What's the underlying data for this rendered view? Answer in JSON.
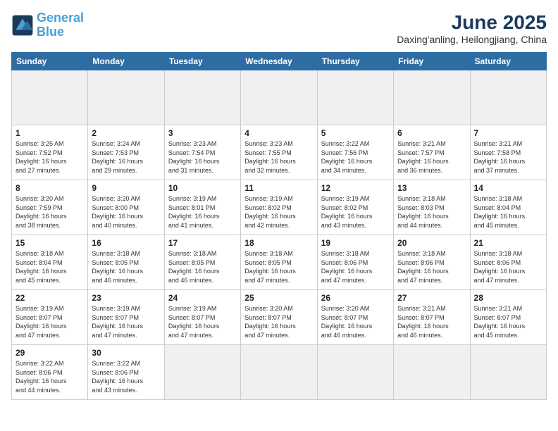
{
  "logo": {
    "line1": "General",
    "line2": "Blue"
  },
  "title": "June 2025",
  "location": "Daxing'anling, Heilongjiang, China",
  "weekdays": [
    "Sunday",
    "Monday",
    "Tuesday",
    "Wednesday",
    "Thursday",
    "Friday",
    "Saturday"
  ],
  "days": [
    {
      "num": "",
      "info": ""
    },
    {
      "num": "",
      "info": ""
    },
    {
      "num": "",
      "info": ""
    },
    {
      "num": "",
      "info": ""
    },
    {
      "num": "",
      "info": ""
    },
    {
      "num": "",
      "info": ""
    },
    {
      "num": "",
      "info": ""
    },
    {
      "num": "1",
      "info": "Sunrise: 3:25 AM\nSunset: 7:52 PM\nDaylight: 16 hours\nand 27 minutes."
    },
    {
      "num": "2",
      "info": "Sunrise: 3:24 AM\nSunset: 7:53 PM\nDaylight: 16 hours\nand 29 minutes."
    },
    {
      "num": "3",
      "info": "Sunrise: 3:23 AM\nSunset: 7:54 PM\nDaylight: 16 hours\nand 31 minutes."
    },
    {
      "num": "4",
      "info": "Sunrise: 3:23 AM\nSunset: 7:55 PM\nDaylight: 16 hours\nand 32 minutes."
    },
    {
      "num": "5",
      "info": "Sunrise: 3:22 AM\nSunset: 7:56 PM\nDaylight: 16 hours\nand 34 minutes."
    },
    {
      "num": "6",
      "info": "Sunrise: 3:21 AM\nSunset: 7:57 PM\nDaylight: 16 hours\nand 36 minutes."
    },
    {
      "num": "7",
      "info": "Sunrise: 3:21 AM\nSunset: 7:58 PM\nDaylight: 16 hours\nand 37 minutes."
    },
    {
      "num": "8",
      "info": "Sunrise: 3:20 AM\nSunset: 7:59 PM\nDaylight: 16 hours\nand 38 minutes."
    },
    {
      "num": "9",
      "info": "Sunrise: 3:20 AM\nSunset: 8:00 PM\nDaylight: 16 hours\nand 40 minutes."
    },
    {
      "num": "10",
      "info": "Sunrise: 3:19 AM\nSunset: 8:01 PM\nDaylight: 16 hours\nand 41 minutes."
    },
    {
      "num": "11",
      "info": "Sunrise: 3:19 AM\nSunset: 8:02 PM\nDaylight: 16 hours\nand 42 minutes."
    },
    {
      "num": "12",
      "info": "Sunrise: 3:19 AM\nSunset: 8:02 PM\nDaylight: 16 hours\nand 43 minutes."
    },
    {
      "num": "13",
      "info": "Sunrise: 3:18 AM\nSunset: 8:03 PM\nDaylight: 16 hours\nand 44 minutes."
    },
    {
      "num": "14",
      "info": "Sunrise: 3:18 AM\nSunset: 8:04 PM\nDaylight: 16 hours\nand 45 minutes."
    },
    {
      "num": "15",
      "info": "Sunrise: 3:18 AM\nSunset: 8:04 PM\nDaylight: 16 hours\nand 45 minutes."
    },
    {
      "num": "16",
      "info": "Sunrise: 3:18 AM\nSunset: 8:05 PM\nDaylight: 16 hours\nand 46 minutes."
    },
    {
      "num": "17",
      "info": "Sunrise: 3:18 AM\nSunset: 8:05 PM\nDaylight: 16 hours\nand 46 minutes."
    },
    {
      "num": "18",
      "info": "Sunrise: 3:18 AM\nSunset: 8:05 PM\nDaylight: 16 hours\nand 47 minutes."
    },
    {
      "num": "19",
      "info": "Sunrise: 3:18 AM\nSunset: 8:06 PM\nDaylight: 16 hours\nand 47 minutes."
    },
    {
      "num": "20",
      "info": "Sunrise: 3:18 AM\nSunset: 8:06 PM\nDaylight: 16 hours\nand 47 minutes."
    },
    {
      "num": "21",
      "info": "Sunrise: 3:18 AM\nSunset: 8:06 PM\nDaylight: 16 hours\nand 47 minutes."
    },
    {
      "num": "22",
      "info": "Sunrise: 3:19 AM\nSunset: 8:07 PM\nDaylight: 16 hours\nand 47 minutes."
    },
    {
      "num": "23",
      "info": "Sunrise: 3:19 AM\nSunset: 8:07 PM\nDaylight: 16 hours\nand 47 minutes."
    },
    {
      "num": "24",
      "info": "Sunrise: 3:19 AM\nSunset: 8:07 PM\nDaylight: 16 hours\nand 47 minutes."
    },
    {
      "num": "25",
      "info": "Sunrise: 3:20 AM\nSunset: 8:07 PM\nDaylight: 16 hours\nand 47 minutes."
    },
    {
      "num": "26",
      "info": "Sunrise: 3:20 AM\nSunset: 8:07 PM\nDaylight: 16 hours\nand 46 minutes."
    },
    {
      "num": "27",
      "info": "Sunrise: 3:21 AM\nSunset: 8:07 PM\nDaylight: 16 hours\nand 46 minutes."
    },
    {
      "num": "28",
      "info": "Sunrise: 3:21 AM\nSunset: 8:07 PM\nDaylight: 16 hours\nand 45 minutes."
    },
    {
      "num": "29",
      "info": "Sunrise: 3:22 AM\nSunset: 8:06 PM\nDaylight: 16 hours\nand 44 minutes."
    },
    {
      "num": "30",
      "info": "Sunrise: 3:22 AM\nSunset: 8:06 PM\nDaylight: 16 hours\nand 43 minutes."
    },
    {
      "num": "",
      "info": ""
    },
    {
      "num": "",
      "info": ""
    },
    {
      "num": "",
      "info": ""
    },
    {
      "num": "",
      "info": ""
    },
    {
      "num": "",
      "info": ""
    }
  ]
}
